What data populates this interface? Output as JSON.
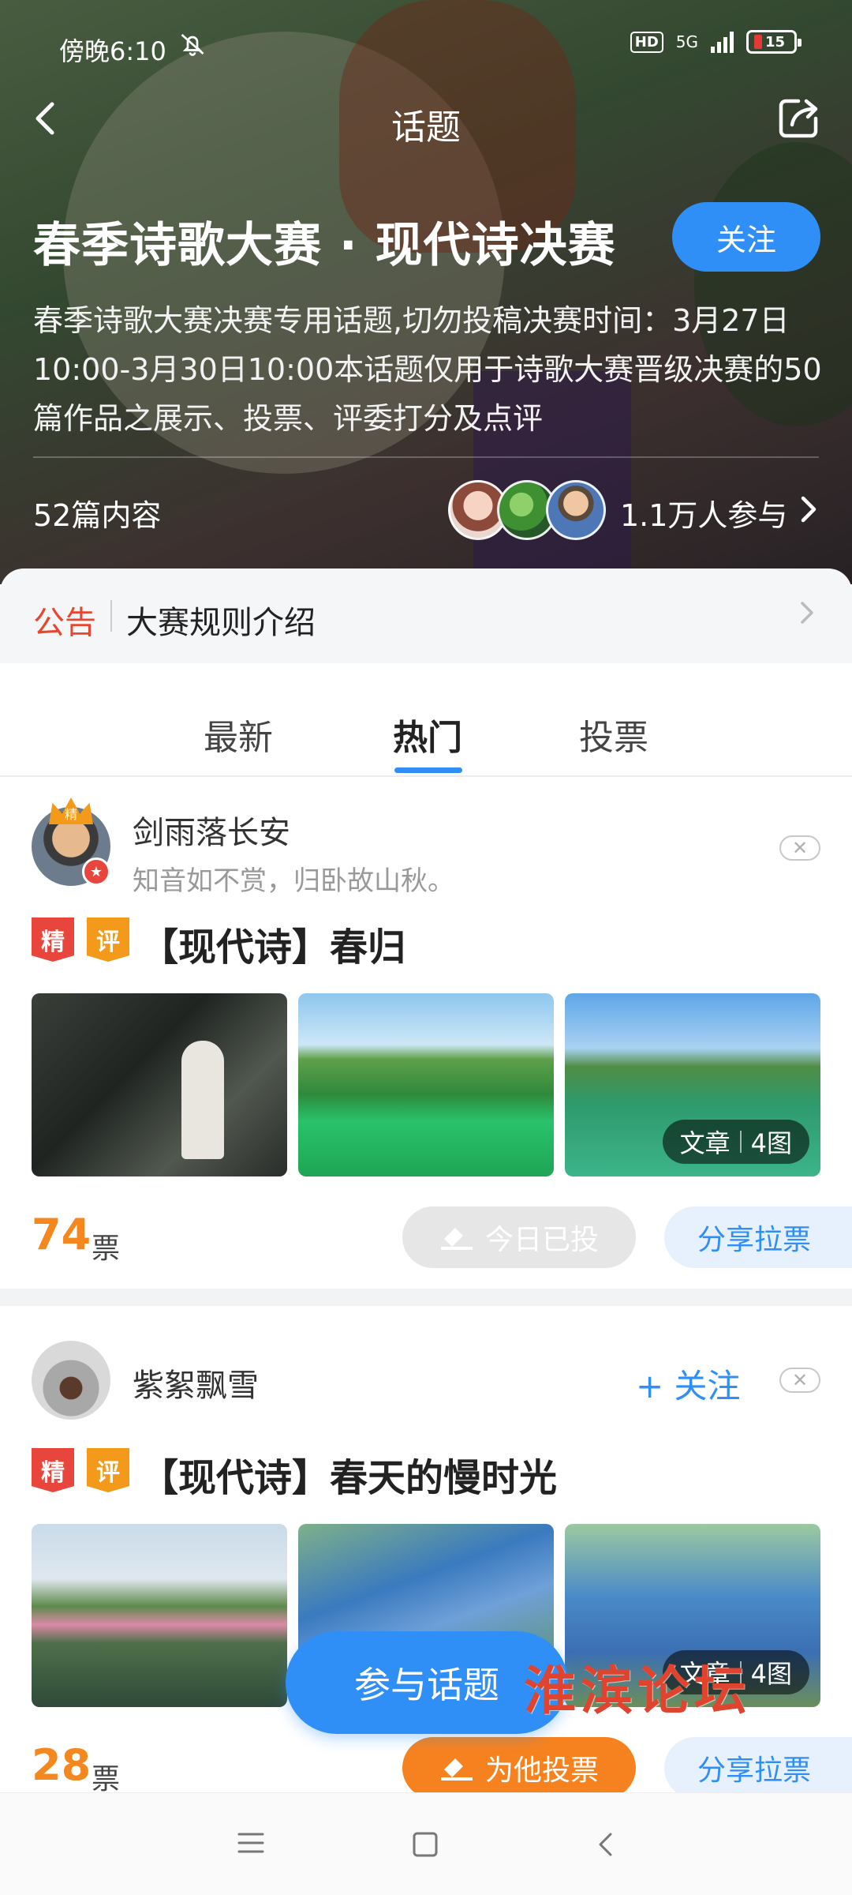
{
  "status_bar": {
    "time": "傍晚6:10",
    "network": "5G",
    "hd": "HD",
    "battery": "15"
  },
  "header": {
    "nav_title": "话题",
    "topic_title": "春季诗歌大赛 · 现代诗决赛",
    "follow_label": "关注",
    "description": "春季诗歌大赛决赛专用话题,切勿投稿决赛时间：3月27日10:00-3月30日10:00本话题仅用于诗歌大赛晋级决赛的50篇作品之展示、投票、评委打分及点评",
    "content_count": "52篇内容",
    "participants": "1.1万人参与"
  },
  "notice": {
    "tag": "公告",
    "text": "大赛规则介绍"
  },
  "tabs": [
    {
      "label": "最新",
      "active": false
    },
    {
      "label": "热门",
      "active": true
    },
    {
      "label": "投票",
      "active": false
    }
  ],
  "posts": [
    {
      "author": "剑雨落长安",
      "signature": "知音如不赏，归卧故山秋。",
      "badges": [
        "精",
        "评"
      ],
      "title": "【现代诗】春归",
      "image_badge": {
        "type": "文章",
        "count": "4图"
      },
      "votes": "74",
      "votes_unit": "票",
      "vote_button": "今日已投",
      "share_button": "分享拉票",
      "avatar_badge": "精"
    },
    {
      "author": "紫絮飘雪",
      "follow_label": "+ 关注",
      "badges": [
        "精",
        "评"
      ],
      "title": "【现代诗】春天的慢时光",
      "image_badge": {
        "type": "文章",
        "count": "4图"
      },
      "votes": "28",
      "votes_unit": "票",
      "vote_button": "为他投票",
      "share_button": "分享拉票"
    }
  ],
  "fab_label": "参与话题",
  "watermark": "淮滨论坛",
  "colors": {
    "accent": "#2f8ff7",
    "orange": "#f6821f",
    "red": "#e8463c",
    "notice_red": "#e8462e"
  }
}
